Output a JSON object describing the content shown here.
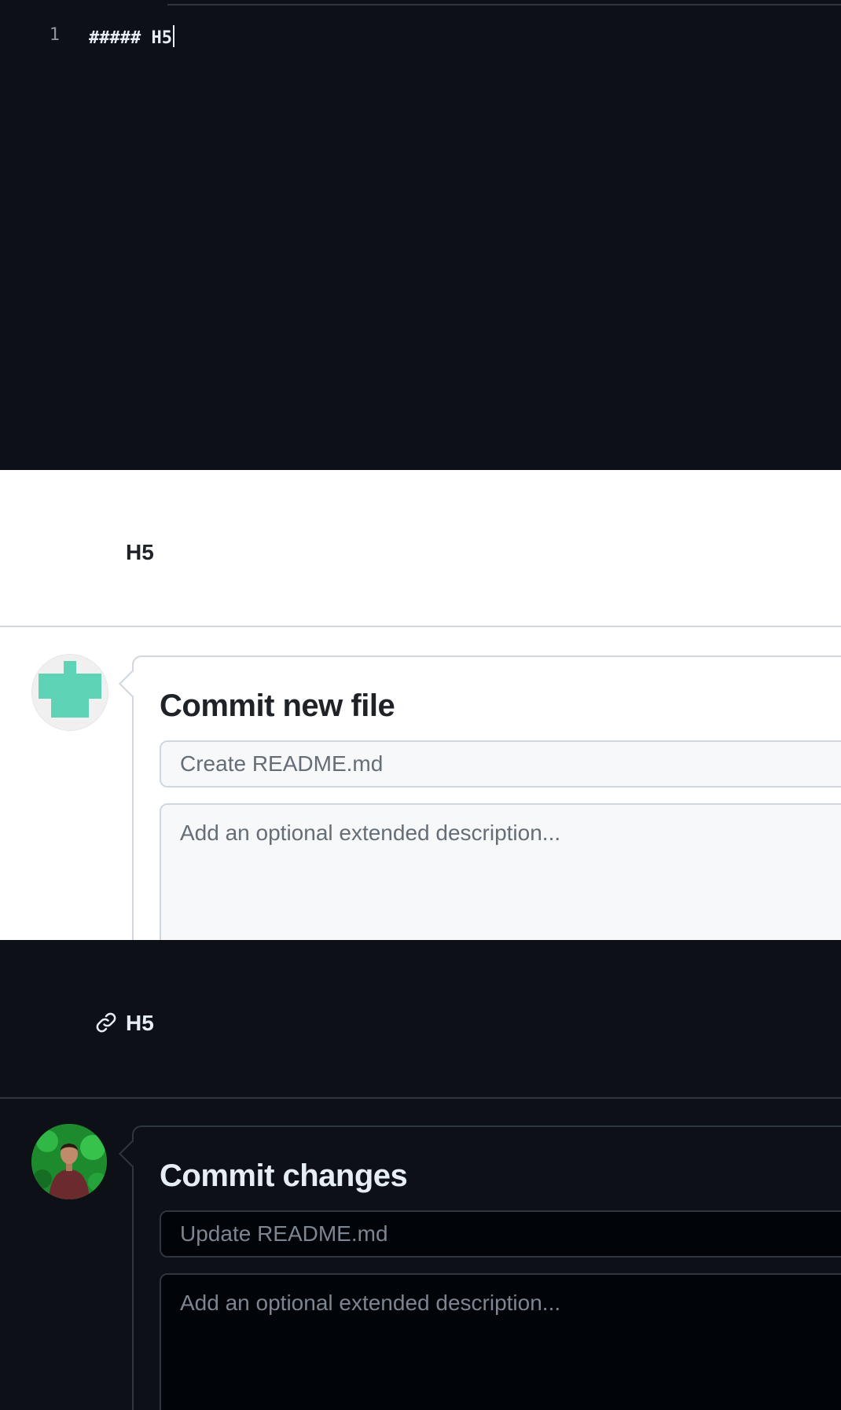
{
  "editor": {
    "line_number": "1",
    "code": "##### H5"
  },
  "light_preview": {
    "heading": "H5",
    "commit": {
      "title": "Commit new file",
      "message_placeholder": "Create README.md",
      "description_placeholder": "Add an optional extended description..."
    }
  },
  "dark_preview": {
    "heading": "H5",
    "commit": {
      "title": "Commit changes",
      "message_placeholder": "Update README.md",
      "description_placeholder": "Add an optional extended description..."
    }
  },
  "icons": {
    "identicon": "identicon-avatar",
    "photo_avatar": "user-photo-avatar",
    "anchor": "link-icon"
  },
  "colors": {
    "identicon": "#5fd3b6",
    "dark_bg": "#0d1117",
    "light_bg": "#ffffff"
  }
}
